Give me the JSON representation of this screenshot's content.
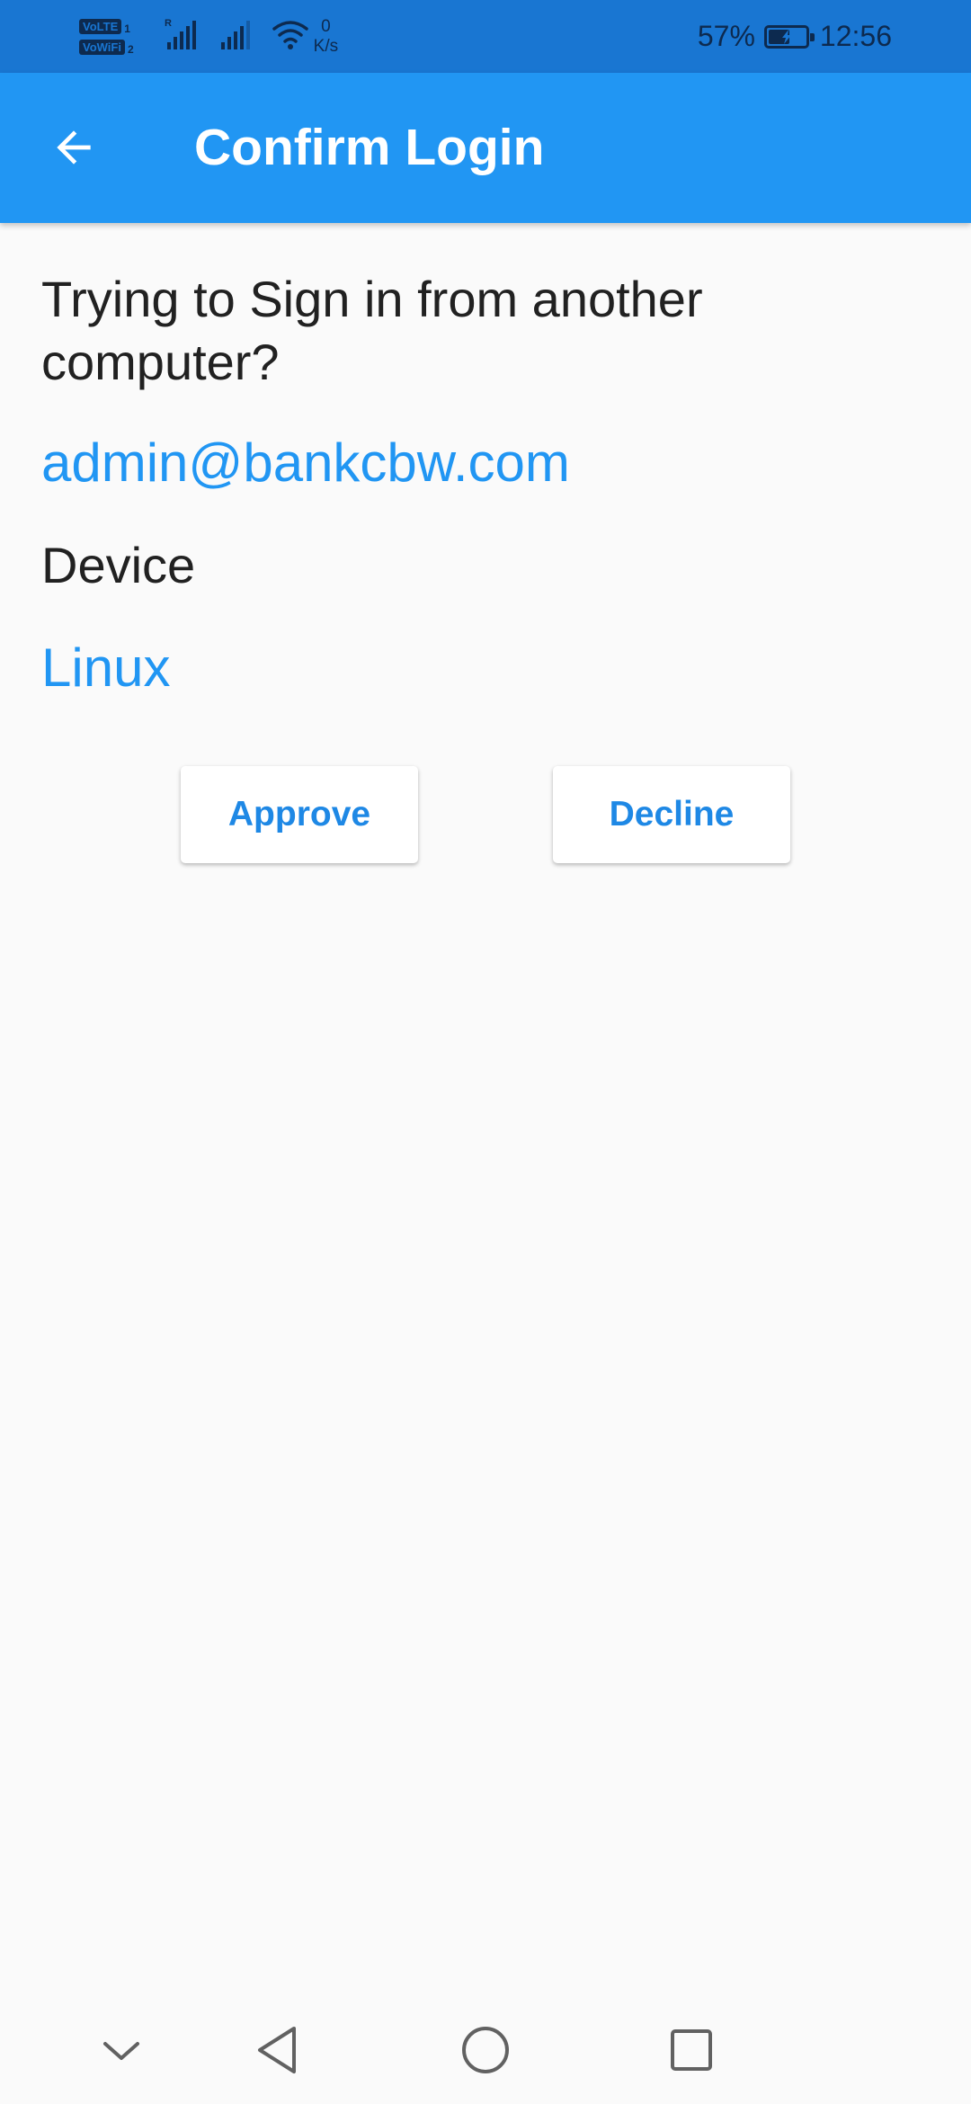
{
  "status_bar": {
    "volte_label": "VoLTE",
    "volte_sub": "1",
    "vowifi_label": "VoWiFi",
    "vowifi_sub": "2",
    "roaming_mark": "R",
    "net_speed_value": "0",
    "net_speed_unit": "K/s",
    "battery_percent": "57%",
    "battery_level": 0.57,
    "time": "12:56"
  },
  "app_bar": {
    "back_icon": "arrow-back-icon",
    "title": "Confirm Login",
    "color": "#2196f3"
  },
  "content": {
    "prompt": "Trying to Sign in from another computer?",
    "email": "admin@bankcbw.com",
    "device_label": "Device",
    "device_value": "Linux",
    "accent_color": "#2196f3"
  },
  "actions": {
    "approve_label": "Approve",
    "decline_label": "Decline"
  },
  "nav_bar": {
    "icons": [
      "chevron-down-icon",
      "nav-back-icon",
      "nav-home-icon",
      "nav-recent-icon"
    ]
  }
}
